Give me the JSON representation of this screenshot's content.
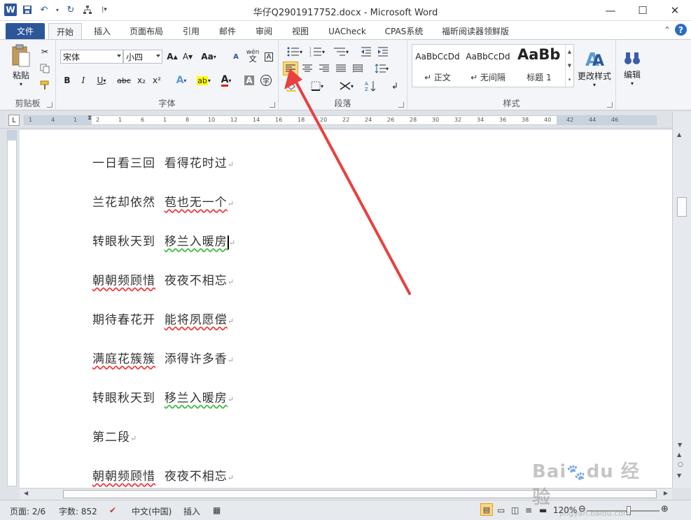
{
  "window": {
    "title": "华仔Q2901917752.docx - Microsoft Word",
    "controls": {
      "minimize": "—",
      "maximize": "☐",
      "close": "✕"
    }
  },
  "ribbon_tabs": [
    "文件",
    "开始",
    "插入",
    "页面布局",
    "引用",
    "邮件",
    "审阅",
    "视图",
    "UACheck",
    "CPAS系统",
    "福昕阅读器领鲜版"
  ],
  "clipboard": {
    "paste": "粘贴",
    "group": "剪贴板"
  },
  "font": {
    "name": "宋体",
    "size": "小四",
    "group": "字体",
    "grow": "A",
    "shrink": "A",
    "case": "Aa",
    "bold": "B",
    "italic": "I",
    "underline": "U",
    "strike": "abc",
    "sub": "x₂",
    "sup": "x²",
    "effects": "A",
    "highlight": "ab",
    "color": "A",
    "shade": "A",
    "enclose": "字",
    "phonetic": "wén",
    "clear": "A"
  },
  "paragraph": {
    "group": "段落"
  },
  "styles": {
    "group": "样式",
    "items": [
      {
        "sample": "AaBbCcDd",
        "name": "↵ 正文"
      },
      {
        "sample": "AaBbCcDd",
        "name": "↵ 无间隔"
      },
      {
        "sample": "AaBb",
        "name": "标题 1"
      }
    ],
    "change": "更改样式"
  },
  "editing": {
    "label": "编辑"
  },
  "document": {
    "lines": [
      {
        "a": "一日看三回",
        "b": "看得花时过"
      },
      {
        "a": "兰花却依然",
        "b": "苞也无一个"
      },
      {
        "a": "转眼秋天到",
        "b": "移兰入暖房"
      },
      {
        "a": "朝朝频顾惜",
        "b": "夜夜不相忘"
      },
      {
        "a": "期待春花开",
        "b": "能将夙愿偿"
      },
      {
        "a": "满庭花簇簇",
        "b": "添得许多香"
      },
      {
        "a": "转眼秋天到",
        "b": "移兰入暖房"
      },
      {
        "a": "第二段",
        "b": ""
      },
      {
        "a": "朝朝频顾惜",
        "b": "夜夜不相忘"
      }
    ],
    "paragraph_mark": "↵"
  },
  "ruler_ticks": [
    "1",
    "4",
    "1",
    "2",
    "1",
    "6",
    "1",
    "8",
    "10",
    "12",
    "14",
    "16",
    "18",
    "20",
    "22",
    "24",
    "26",
    "28",
    "30",
    "32",
    "34",
    "36",
    "38",
    "40",
    "42",
    "44",
    "46"
  ],
  "status": {
    "page": "页面: 2/6",
    "words": "字数: 852",
    "language": "中文(中国)",
    "mode": "插入",
    "zoom": "120%"
  },
  "watermark": "Baidu 经验\njingyan.baidu.com",
  "colors": {
    "accent": "#2b579a",
    "arrow": "#e8413f",
    "active_align": "#fcd587"
  }
}
